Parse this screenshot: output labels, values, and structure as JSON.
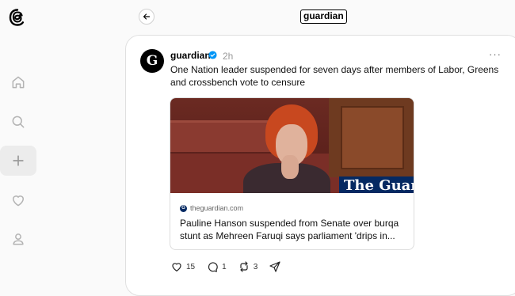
{
  "header": {
    "title": "guardian"
  },
  "sidebar": {
    "items": [
      "home-icon",
      "search-icon",
      "plus-icon",
      "heart-icon",
      "profile-icon"
    ]
  },
  "post": {
    "username": "guardian",
    "time": "2h",
    "more": "···",
    "text": "One Nation leader suspended for seven days after members of Labor, Greens and crossbench vote to censure",
    "link": {
      "masthead": "The Guardian",
      "domain": "theguardian.com",
      "title": "Pauline Hanson suspended from Senate over burqa stunt as Mehreen Faruqi says parliament 'drips in..."
    },
    "actions": {
      "likes": "15",
      "replies": "1",
      "reposts": "3"
    }
  }
}
